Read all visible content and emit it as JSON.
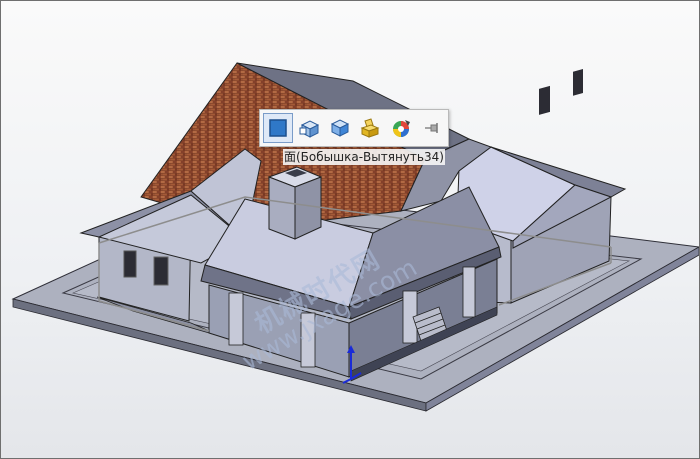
{
  "toolbar": {
    "items": [
      {
        "icon": "normal-to-face-icon",
        "active": true
      },
      {
        "icon": "sketch-on-face-icon"
      },
      {
        "icon": "edit-feature-icon"
      },
      {
        "icon": "part-body-icon"
      },
      {
        "icon": "appearance-icon"
      },
      {
        "icon": "pin-icon"
      }
    ]
  },
  "tooltip": {
    "text": "面(Бобышка-Вытянуть34)"
  },
  "watermark": {
    "line1": "机械时代网",
    "line2": "www.jxage.com"
  },
  "colors": {
    "wall": "#b3b8c9",
    "roof_brick": "#8a4a30",
    "base_slab": "#a9adbb",
    "selection_edge": "#8d8d8d",
    "triad_axis": "#1a2bd8"
  }
}
